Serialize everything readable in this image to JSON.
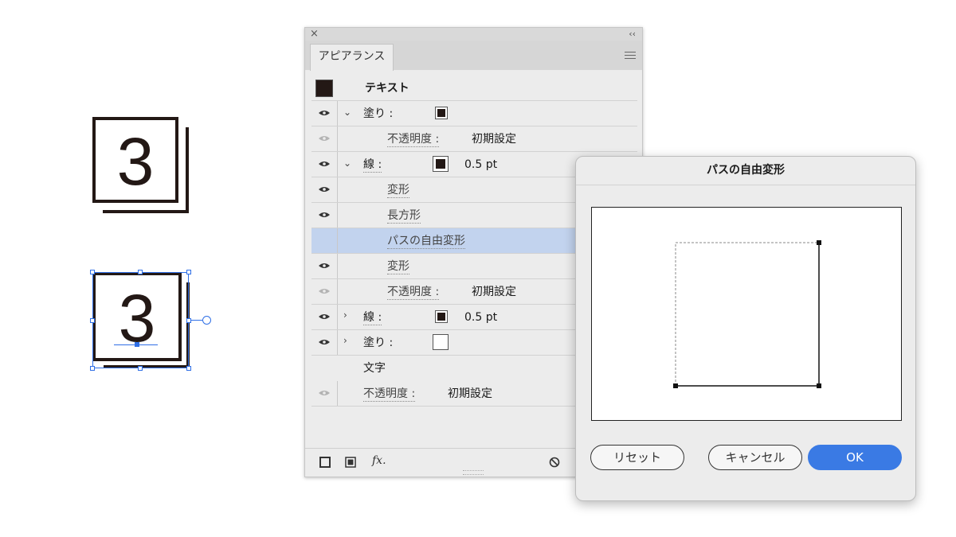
{
  "artboard": {
    "sample_top": {
      "digit": "3"
    },
    "sample_bottom": {
      "digit": "3"
    }
  },
  "panel": {
    "close_icon": "×",
    "collapse_icon": "‹‹",
    "tab_label": "アピアランス",
    "rows": {
      "text": {
        "label": "テキスト"
      },
      "fill1": {
        "label": "塗り :"
      },
      "opacity1": {
        "label": "不透明度 :",
        "value": "初期設定"
      },
      "stroke1": {
        "label": "線 :",
        "value": "0.5 pt"
      },
      "effect_transform1": {
        "label": "変形"
      },
      "effect_rect": {
        "label": "長方形"
      },
      "effect_free_distort": {
        "label": "パスの自由変形"
      },
      "effect_transform2": {
        "label": "変形"
      },
      "opacity2": {
        "label": "不透明度 :",
        "value": "初期設定"
      },
      "stroke2": {
        "label": "線 :",
        "value": "0.5 pt"
      },
      "fill2": {
        "label": "塗り :"
      },
      "characters": {
        "label": "文字"
      },
      "opacity3": {
        "label": "不透明度 :",
        "value": "初期設定"
      }
    },
    "bottom": {
      "fx_label": "fx."
    }
  },
  "dialog": {
    "title": "パスの自由変形",
    "reset_label": "リセット",
    "cancel_label": "キャンセル",
    "ok_label": "OK"
  },
  "colors": {
    "ink": "#231815",
    "selection": "#2f6fe6",
    "row_selected": "#c2d3ee",
    "ok_button": "#3a7ae4"
  }
}
